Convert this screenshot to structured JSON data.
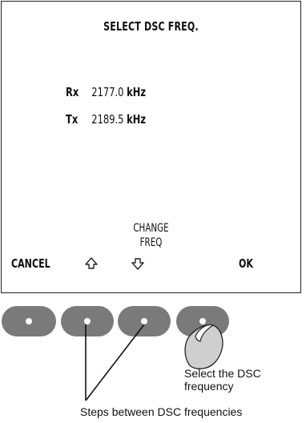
{
  "screen": {
    "title": "SELECT DSC FREQ.",
    "rx": {
      "label": "Rx",
      "value": "2177.0",
      "unit": "kHz"
    },
    "tx": {
      "label": "Tx",
      "value": "2189.5",
      "unit": "kHz"
    },
    "change_line1": "CHANGE",
    "change_line2": "FREQ",
    "softkeys": {
      "cancel": "CANCEL",
      "ok": "OK",
      "up_icon": "up-arrow-icon",
      "down_icon": "down-arrow-icon"
    }
  },
  "annotations": {
    "select_line1": "Select the DSC",
    "select_line2": "frequency",
    "steps": "Steps between DSC frequencies"
  }
}
